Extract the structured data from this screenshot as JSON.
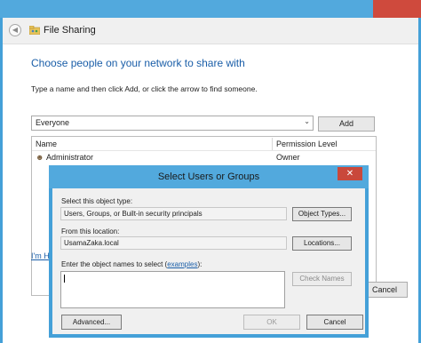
{
  "window": {
    "title": "File Sharing",
    "back_icon": "back-arrow-icon",
    "share_icon": "file-sharing-icon",
    "close_icon": "close-icon"
  },
  "sharing": {
    "heading": "Choose people on your network to share with",
    "instruction": "Type a name and then click Add, or click the arrow to find someone.",
    "combo_value": "Everyone",
    "add_label": "Add",
    "columns": [
      "Name",
      "Permission Level"
    ],
    "rows": [
      {
        "name": "Administrator",
        "permission": "Owner",
        "icon": "user-icon"
      }
    ],
    "link_stub": "I'm H",
    "cancel_label": "Cancel"
  },
  "dialog": {
    "title": "Select Users or Groups",
    "object_type_label": "Select this object type:",
    "object_type_value": "Users, Groups, or Built-in security principals",
    "object_types_button": "Object Types...",
    "location_label": "From this location:",
    "location_value": "UsamaZaka.local",
    "locations_button": "Locations...",
    "enter_label": "Enter the object names to select",
    "examples_link": "examples",
    "check_names_button": "Check Names",
    "advanced_button": "Advanced...",
    "ok_button": "OK",
    "cancel_button": "Cancel"
  },
  "colors": {
    "titlebar": "#52a9dd",
    "close": "#c9483b",
    "heading": "#1a5ea8"
  }
}
